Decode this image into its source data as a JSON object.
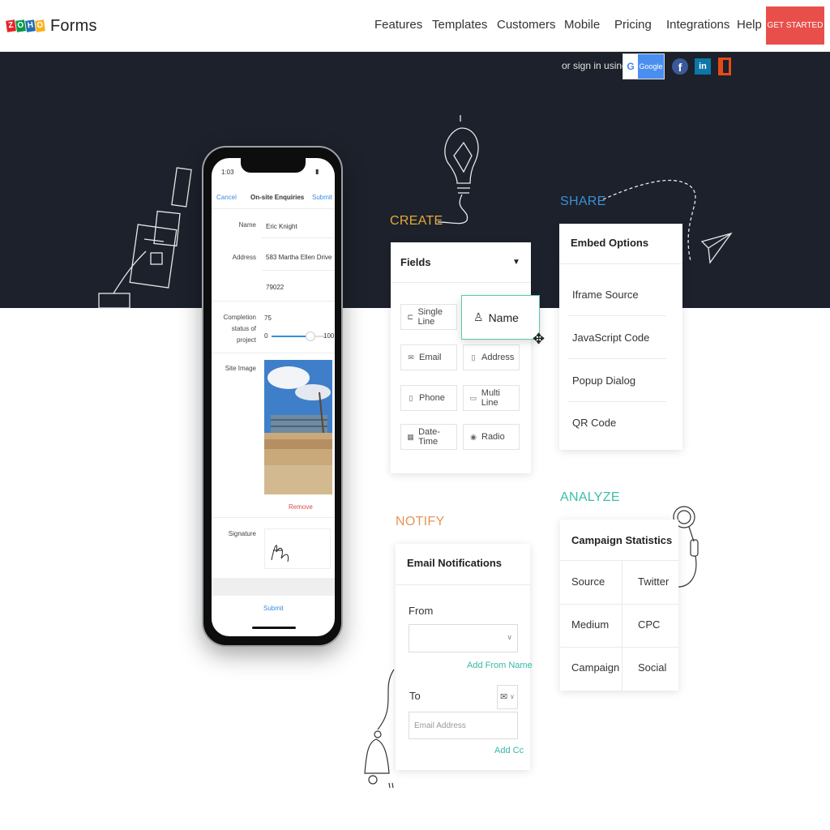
{
  "brand": {
    "logo_letters": [
      "Z",
      "O",
      "H",
      "O"
    ],
    "logo_colors": [
      "#e42527",
      "#089949",
      "#226db4",
      "#f9b21d"
    ],
    "product": "Forms"
  },
  "nav": {
    "items": [
      "Features",
      "Templates",
      "Customers",
      "Mobile",
      "Pricing",
      "Integrations",
      "Help"
    ],
    "cta": "GET STARTED"
  },
  "signin": {
    "text": "or sign in using",
    "google": "Google",
    "providers": [
      "google-icon",
      "facebook-icon",
      "linkedin-icon",
      "office-icon"
    ]
  },
  "phone": {
    "time": "1:03",
    "cancel": "Cancel",
    "title": "On-site Enquiries",
    "submit_top": "Submit",
    "fields": {
      "name_label": "Name",
      "name_value": "Eric Knight",
      "address_label": "Address",
      "address_line1": "583 Martha Ellen Drive",
      "address_zip": "79022",
      "completion_label": "Completion status of project",
      "completion_value": "75",
      "slider_min": "0",
      "slider_max": "100",
      "site_image_label": "Site Image",
      "remove": "Remove",
      "signature_label": "Signature"
    },
    "submit_bottom": "Submit"
  },
  "create": {
    "section": "CREATE",
    "fields_title": "Fields",
    "buttons": [
      {
        "label": "Single Line",
        "icon": "single-line-icon"
      },
      {
        "label": "Email",
        "icon": "email-icon"
      },
      {
        "label": "Address",
        "icon": "address-icon"
      },
      {
        "label": "Phone",
        "icon": "phone-icon"
      },
      {
        "label": "Multi Line",
        "icon": "multi-line-icon"
      },
      {
        "label": "Date-Time",
        "icon": "date-time-icon"
      },
      {
        "label": "Radio",
        "icon": "radio-icon"
      }
    ],
    "drag_item": "Name"
  },
  "share": {
    "section": "SHARE",
    "title": "Embed Options",
    "items": [
      "Iframe Source",
      "JavaScript Code",
      "Popup Dialog",
      "QR Code"
    ]
  },
  "notify": {
    "section": "NOTIFY",
    "title": "Email Notifications",
    "from_label": "From",
    "add_from_name": "Add From Name",
    "to_label": "To",
    "email_placeholder": "Email Address",
    "add_cc": "Add Cc"
  },
  "analyze": {
    "section": "ANALYZE",
    "title": "Campaign Statistics",
    "rows": [
      [
        "Source",
        "Twitter"
      ],
      [
        "Medium",
        "CPC"
      ],
      [
        "Campaign",
        "Social"
      ]
    ]
  },
  "colors": {
    "dark_band": "#1c212b",
    "cta": "#e94f4a",
    "create": "#e5a93a",
    "share": "#3b8fd6",
    "notify": "#e8935a",
    "analyze": "#3cbfa8",
    "accent_link": "#35b9a6"
  }
}
